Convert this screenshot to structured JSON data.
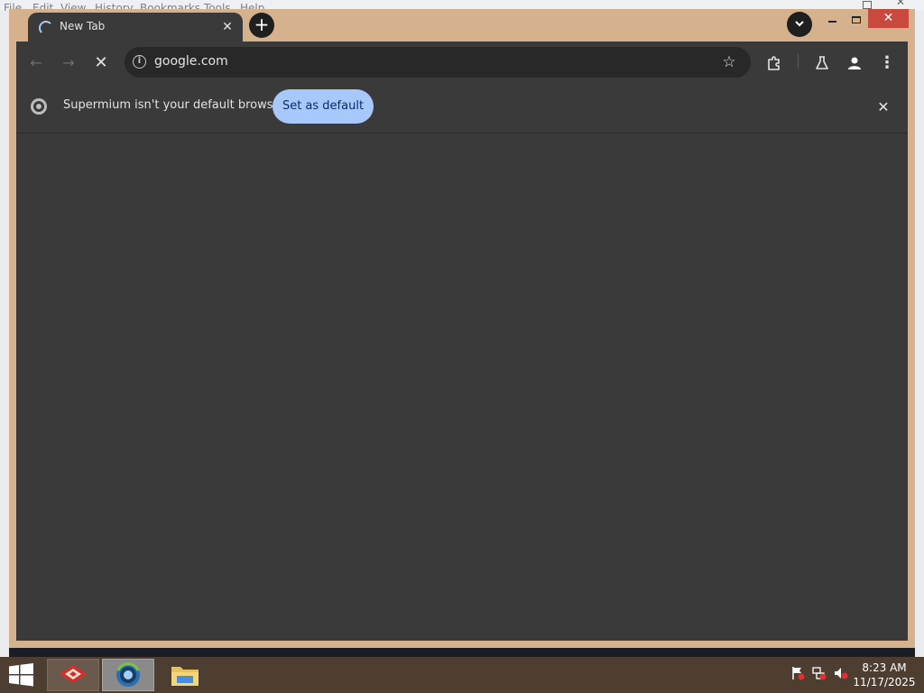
{
  "background_app": {
    "menu": [
      "File",
      "Edit",
      "View",
      "History",
      "Bookmarks",
      "Tools",
      "Help"
    ]
  },
  "tab": {
    "title": "New Tab",
    "close_glyph": "✕"
  },
  "new_tab_glyph": "+",
  "window_controls": {
    "close_glyph": "✕"
  },
  "toolbar": {
    "back_glyph": "←",
    "forward_glyph": "→",
    "stop_glyph": "✕",
    "url": "google.com",
    "site_info_glyph": "i",
    "bookmark_glyph": "☆",
    "menu_glyph": "⋮"
  },
  "infobar": {
    "message": "Supermium isn't your default browser",
    "button_label": "Set as default",
    "close_glyph": "✕"
  },
  "taskbar": {
    "time": "8:23 AM",
    "date": "11/17/2025"
  },
  "colors": {
    "window_frame": "#d6b18e",
    "chrome_bg": "#3a3a3a",
    "accent": "#a8c7fa",
    "taskbar": "#4e3e32",
    "close_red": "#c84a3f"
  },
  "icons": [
    "tab-loading-icon",
    "site-info-icon",
    "bookmark-star-icon",
    "extensions-icon",
    "labs-icon",
    "profile-icon",
    "kebab-menu-icon",
    "chromium-logo-icon",
    "windows-start-icon",
    "flag-icon",
    "network-icon",
    "speaker-muted-icon"
  ]
}
